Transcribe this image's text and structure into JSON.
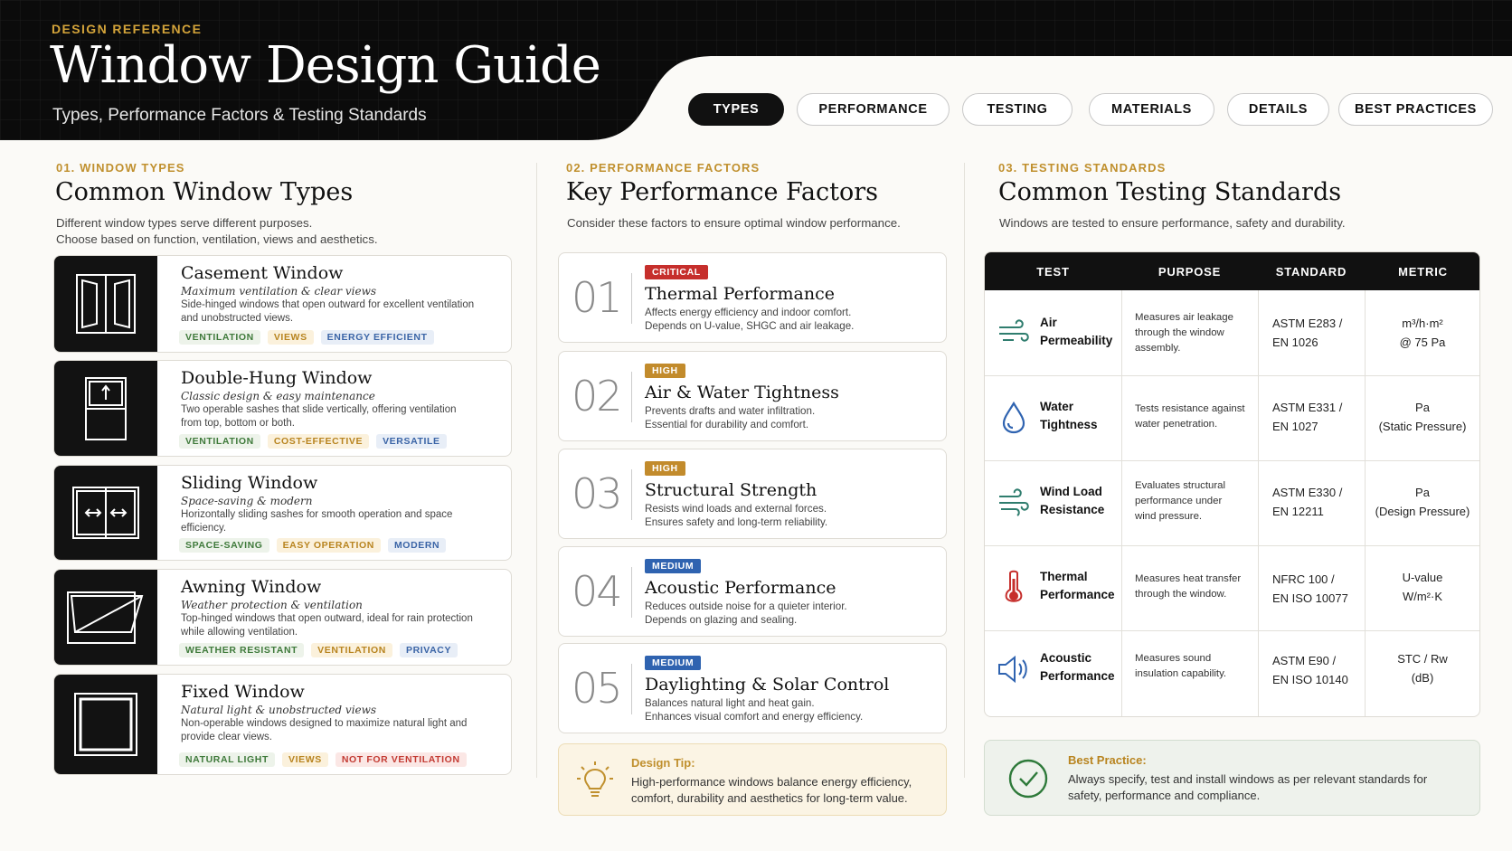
{
  "header": {
    "eyebrow": "DESIGN REFERENCE",
    "title": "Window Design Guide",
    "subtitle": "Types, Performance Factors & Testing Standards"
  },
  "nav": [
    "TYPES",
    "PERFORMANCE",
    "TESTING",
    "MATERIALS",
    "DETAILS",
    "BEST PRACTICES"
  ],
  "nav_active": "TYPES",
  "types": {
    "kicker": "01. WINDOW TYPES",
    "title": "Common Window Types",
    "desc1": "Different window types serve different purposes.",
    "desc2": "Choose based on function, ventilation, views and aesthetics.",
    "items": [
      {
        "name": "Casement Window",
        "sub": "Maximum ventilation & clear views",
        "desc": "Side-hinged windows that open outward for excellent ventilation and unobstructed views.",
        "tags": [
          {
            "label": "VENTILATION",
            "color": "green"
          },
          {
            "label": "VIEWS",
            "color": "yellow"
          },
          {
            "label": "ENERGY EFFICIENT",
            "color": "blue"
          }
        ]
      },
      {
        "name": "Double-Hung Window",
        "sub": "Classic design & easy maintenance",
        "desc": "Two operable sashes that slide vertically, offering ventilation from top, bottom or both.",
        "tags": [
          {
            "label": "VENTILATION",
            "color": "green"
          },
          {
            "label": "COST-EFFECTIVE",
            "color": "yellow"
          },
          {
            "label": "VERSATILE",
            "color": "blue"
          }
        ]
      },
      {
        "name": "Sliding Window",
        "sub": "Space-saving & modern",
        "desc": "Horizontally sliding sashes for smooth operation and space efficiency.",
        "tags": [
          {
            "label": "SPACE-SAVING",
            "color": "green"
          },
          {
            "label": "EASY OPERATION",
            "color": "yellow"
          },
          {
            "label": "MODERN",
            "color": "blue"
          }
        ]
      },
      {
        "name": "Awning Window",
        "sub": "Weather protection & ventilation",
        "desc": "Top-hinged windows that open outward, ideal for rain protection while allowing ventilation.",
        "tags": [
          {
            "label": "WEATHER RESISTANT",
            "color": "green"
          },
          {
            "label": "VENTILATION",
            "color": "yellow"
          },
          {
            "label": "PRIVACY",
            "color": "blue"
          }
        ]
      },
      {
        "name": "Fixed Window",
        "sub": "Natural light & unobstructed views",
        "desc": "Non-operable windows designed to maximize natural light and provide clear views.",
        "tags": [
          {
            "label": "NATURAL LIGHT",
            "color": "green"
          },
          {
            "label": "VIEWS",
            "color": "yellow"
          },
          {
            "label": "NOT FOR VENTILATION",
            "color": "red"
          }
        ]
      }
    ]
  },
  "performance": {
    "kicker": "02. PERFORMANCE FACTORS",
    "title": "Key Performance Factors",
    "desc": "Consider these factors to ensure optimal window performance.",
    "items": [
      {
        "num": "01",
        "badge": "CRITICAL",
        "level": "crit",
        "title": "Thermal Performance",
        "line1": "Affects energy efficiency and indoor comfort.",
        "line2": "Depends on U-value, SHGC and air leakage."
      },
      {
        "num": "02",
        "badge": "HIGH",
        "level": "high",
        "title": "Air & Water Tightness",
        "line1": "Prevents drafts and water infiltration.",
        "line2": "Essential for durability and comfort."
      },
      {
        "num": "03",
        "badge": "HIGH",
        "level": "high",
        "title": "Structural Strength",
        "line1": "Resists wind loads and external forces.",
        "line2": "Ensures safety and long-term reliability."
      },
      {
        "num": "04",
        "badge": "MEDIUM",
        "level": "med",
        "title": "Acoustic Performance",
        "line1": "Reduces outside noise for a quieter interior.",
        "line2": "Depends on glazing and sealing."
      },
      {
        "num": "05",
        "badge": "MEDIUM",
        "level": "med",
        "title": "Daylighting & Solar Control",
        "line1": "Balances natural light and heat gain.",
        "line2": "Enhances visual comfort and energy efficiency."
      }
    ],
    "tip": {
      "title": "Design Tip:",
      "text": "High-performance windows balance energy efficiency, comfort, durability and aesthetics for long-term value."
    }
  },
  "testing": {
    "kicker": "03. TESTING STANDARDS",
    "title": "Common Testing Standards",
    "desc": "Windows are tested to ensure performance, safety and durability.",
    "columns": [
      "TEST",
      "PURPOSE",
      "STANDARD",
      "METRIC"
    ],
    "rows": [
      {
        "icon": "wind-icon",
        "t1": "Air",
        "t2": "Permeability",
        "purpose": [
          "Measures air leakage",
          "through the window",
          "assembly."
        ],
        "s1": "ASTM E283 /",
        "s2": "EN 1026",
        "m1": "m³/h·m²",
        "m2": "@ 75 Pa"
      },
      {
        "icon": "water-drop-icon",
        "t1": "Water",
        "t2": "Tightness",
        "purpose": [
          "Tests resistance against",
          "water penetration."
        ],
        "s1": "ASTM E331 /",
        "s2": "EN 1027",
        "m1": "Pa",
        "m2": "(Static Pressure)"
      },
      {
        "icon": "wind-load-icon",
        "t1": "Wind Load",
        "t2": "Resistance",
        "purpose": [
          "Evaluates structural",
          "performance under",
          "wind pressure."
        ],
        "s1": "ASTM E330 /",
        "s2": "EN 12211",
        "m1": "Pa",
        "m2": "(Design Pressure)"
      },
      {
        "icon": "thermometer-icon",
        "t1": "Thermal",
        "t2": "Performance",
        "purpose": [
          "Measures heat transfer",
          "through the window."
        ],
        "s1": "NFRC 100 /",
        "s2": "EN ISO 10077",
        "m1": "U-value",
        "m2": "W/m²·K"
      },
      {
        "icon": "speaker-icon",
        "t1": "Acoustic",
        "t2": "Performance",
        "purpose": [
          "Measures sound",
          "insulation capability."
        ],
        "s1": "ASTM E90 /",
        "s2": "EN ISO 10140",
        "m1": "STC / Rw",
        "m2": "(dB)"
      }
    ],
    "best_practice": {
      "title": "Best Practice:",
      "text": "Always specify, test and install windows as per relevant standards for safety, performance and compliance."
    }
  },
  "colors": {
    "gold": "#c0902e",
    "dark": "#111111",
    "critical": "#c62f2c",
    "high": "#c28b2c",
    "medium": "#2f63b0"
  }
}
